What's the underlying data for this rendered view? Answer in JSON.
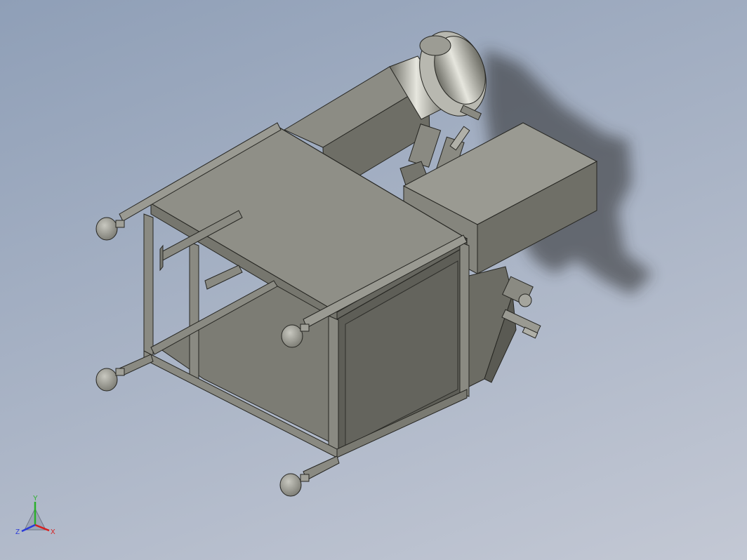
{
  "triad": {
    "x_label": "X",
    "y_label": "Y",
    "z_label": "Z",
    "x_color": "#d81e1e",
    "y_color": "#2bb02b",
    "z_color": "#2b3bd8"
  },
  "colors": {
    "background_top": "#8f9fb7",
    "background_bottom": "#c3c8d4",
    "steel_light": "#9c9c92",
    "steel_mid": "#7a7a72",
    "steel_dark": "#55554f",
    "edge": "#262622",
    "shadow": "#2a2a2a"
  }
}
